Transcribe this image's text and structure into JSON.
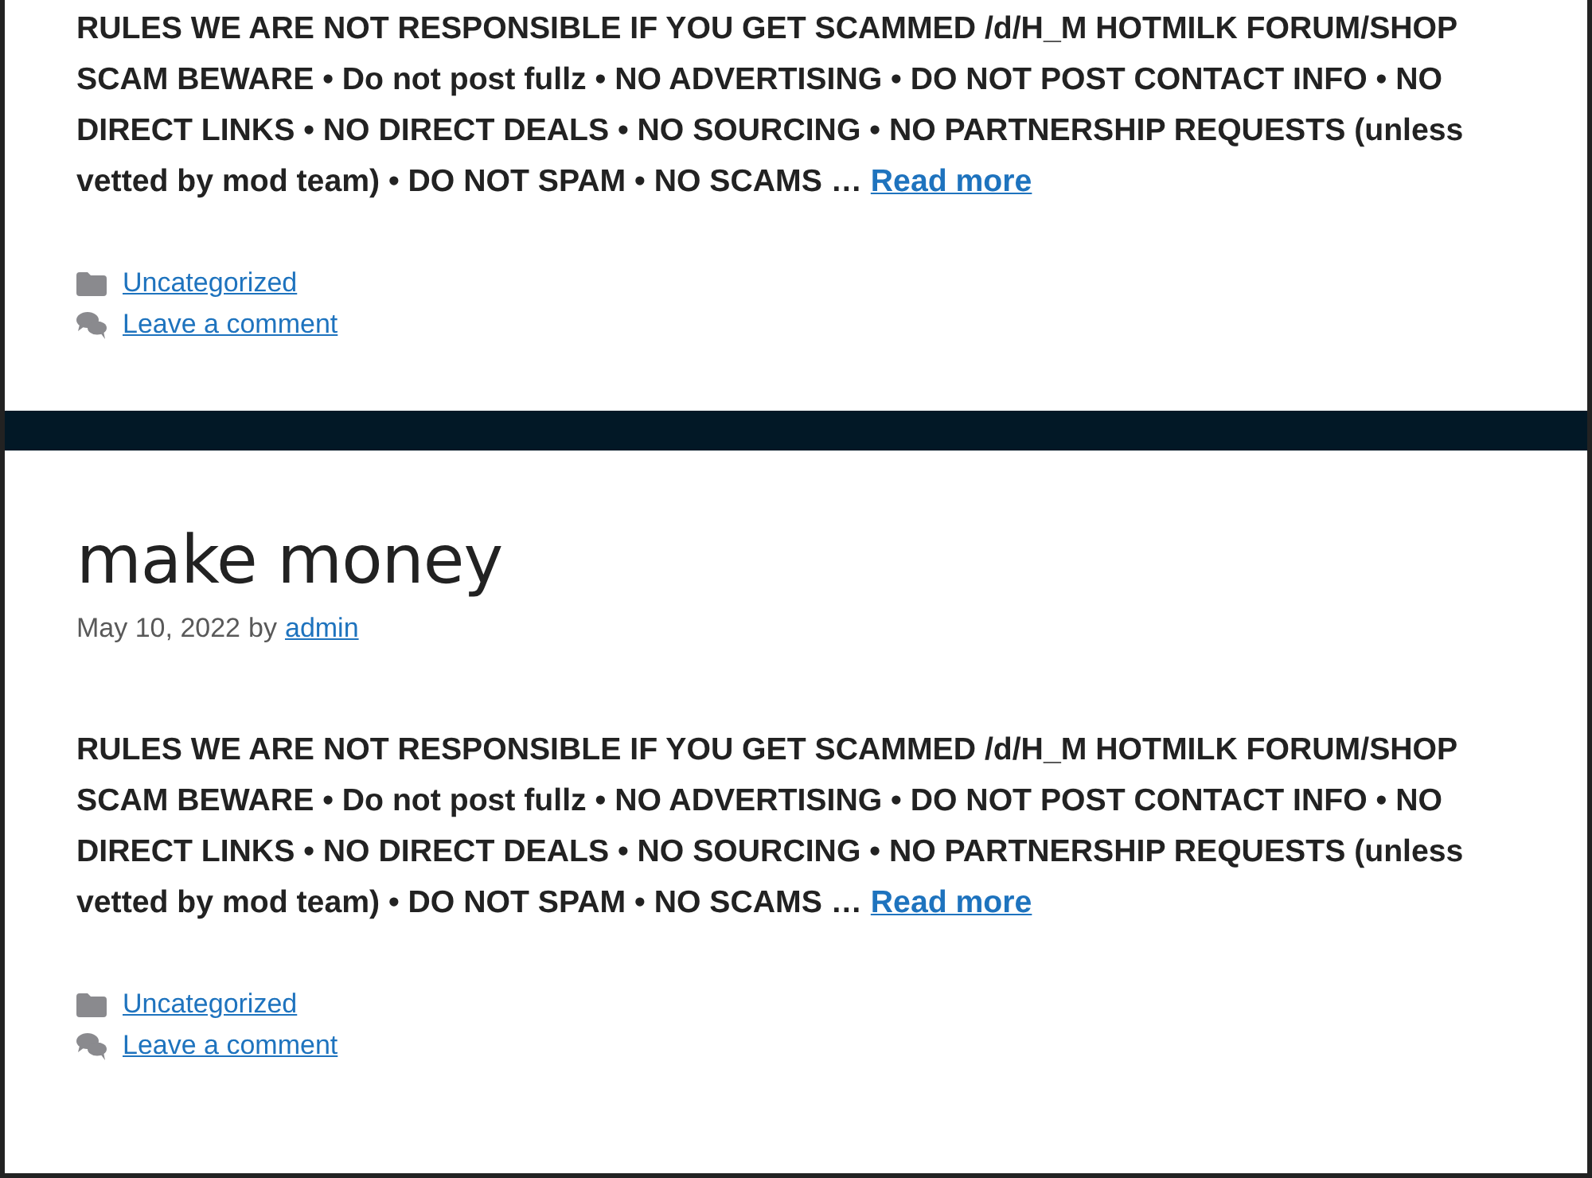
{
  "posts": [
    {
      "excerpt": "RULES WE ARE NOT RESPONSIBLE IF YOU GET SCAMMED /d/H_M HOTMILK FORUM/SHOP SCAM BEWARE • Do not post fullz • NO ADVERTISING • DO NOT POST CONTACT INFO • NO DIRECT LINKS • NO DIRECT DEALS • NO SOURCING • NO PARTNERSHIP REQUESTS (unless vetted by mod team) • DO NOT SPAM • NO SCAMS …",
      "read_more": "Read more",
      "category": "Uncategorized",
      "comment_link": "Leave a comment"
    },
    {
      "title": "make money",
      "date": "May 10, 2022",
      "by": "by",
      "author": "admin",
      "excerpt": "RULES WE ARE NOT RESPONSIBLE IF YOU GET SCAMMED /d/H_M HOTMILK FORUM/SHOP SCAM BEWARE • Do not post fullz • NO ADVERTISING • DO NOT POST CONTACT INFO • NO DIRECT LINKS • NO DIRECT DEALS • NO SOURCING • NO PARTNERSHIP REQUESTS (unless vetted by mod team) • DO NOT SPAM • NO SCAMS …",
      "read_more": "Read more",
      "category": "Uncategorized",
      "comment_link": "Leave a comment"
    }
  ]
}
